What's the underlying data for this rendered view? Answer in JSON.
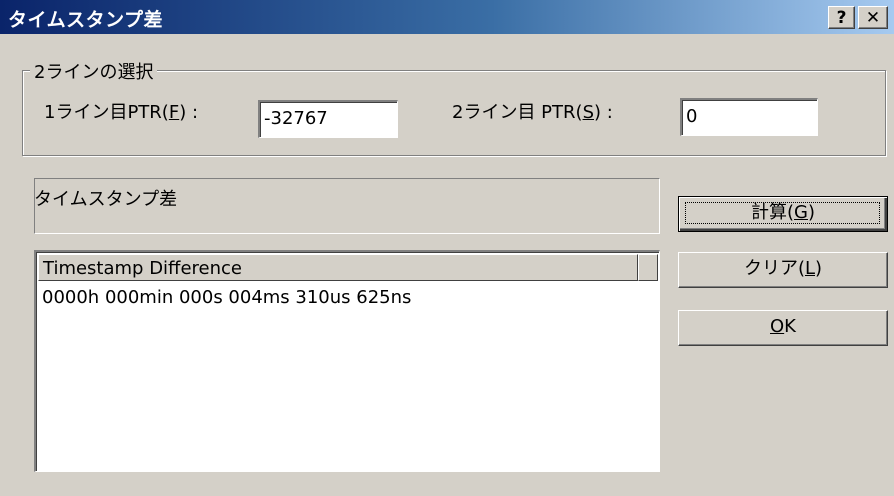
{
  "window": {
    "title": "タイムスタンプ差",
    "help_button": "?",
    "close_button": "✕"
  },
  "group": {
    "legend": "2ラインの選択",
    "field1": {
      "label_prefix": "1ライン目PTR(",
      "label_key": "F",
      "label_suffix": ") :",
      "value": "-32767"
    },
    "field2": {
      "label_prefix": "2ライン目 PTR(",
      "label_key": "S",
      "label_suffix": ") :",
      "value": "0"
    }
  },
  "result": {
    "label": "タイムスタンプ差"
  },
  "list": {
    "columns": [
      "Timestamp Difference"
    ],
    "rows": [
      "0000h 000min 000s 004ms 310us 625ns"
    ]
  },
  "buttons": {
    "calc": {
      "prefix": "計算(",
      "key": "G",
      "suffix": ")"
    },
    "clear": {
      "prefix": "クリア(",
      "key": "L",
      "suffix": ")"
    },
    "ok": {
      "key": "O",
      "suffix": "K"
    }
  }
}
